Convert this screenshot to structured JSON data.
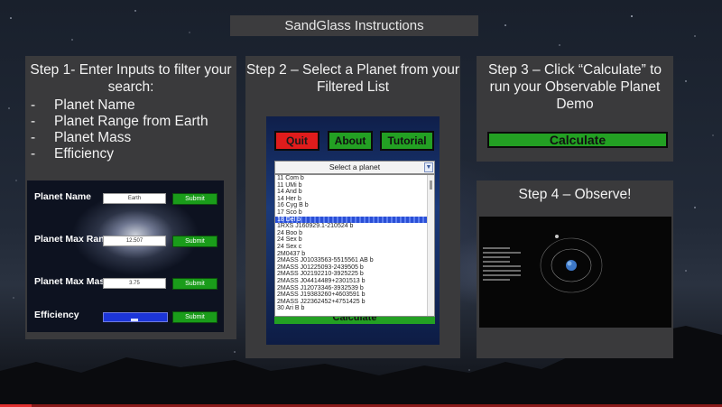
{
  "header": {
    "title": "SandGlass Instructions"
  },
  "step1": {
    "title": "Step 1- Enter Inputs to filter your search:",
    "bullets": [
      "Planet Name",
      "Planet Range from Earth",
      "Planet Mass",
      "Efficiency"
    ],
    "form": {
      "rows": [
        {
          "label": "Planet Name",
          "input_value": "Earth",
          "submit_label": "Submit"
        },
        {
          "label": "Planet Max Range",
          "input_value": "12.507",
          "submit_label": "Submit"
        },
        {
          "label": "Planet Max Mass",
          "input_value": "3.75",
          "submit_label": "Submit"
        },
        {
          "label": "Efficiency",
          "submit_label": "Submit"
        }
      ]
    }
  },
  "step2": {
    "title": "Step 2 – Select a Planet from your Filtered List",
    "buttons": {
      "quit": "Quit",
      "about": "About",
      "tutorial": "Tutorial"
    },
    "select_placeholder": "Select a planet",
    "planets": [
      "11 Com b",
      "11 UMi b",
      "14 And b",
      "14 Her b",
      "16 Cyg B b",
      "17 Sco b",
      "18 Del b",
      "1RXS J160929.1-210524 b",
      "24 Boo b",
      "24 Sex b",
      "24 Sex c",
      "2M0437 b",
      "2MASS J01033563-5515561 AB b",
      "2MASS J01225093-2439505 b",
      "2MASS J02192210-3925225 b",
      "2MASS J04414489+2301513 b",
      "2MASS J12073346-3932539 b",
      "2MASS J19383260+4603591 b",
      "2MASS J22362452+4751425 b",
      "30 Ari B b"
    ],
    "selected_index": 6,
    "calculate_label": "Calculate"
  },
  "step3": {
    "title": "Step 3 – Click “Calculate” to run your Observable Planet Demo",
    "calculate_label": "Calculate"
  },
  "step4": {
    "title": "Step 4 – Observe!"
  },
  "colors": {
    "panel": "#3a3a3c",
    "submit_green": "#1a9c1a",
    "quit_red": "#e01c1c",
    "slider_blue": "#1c35d8",
    "selection_blue": "#2a4fd6"
  }
}
